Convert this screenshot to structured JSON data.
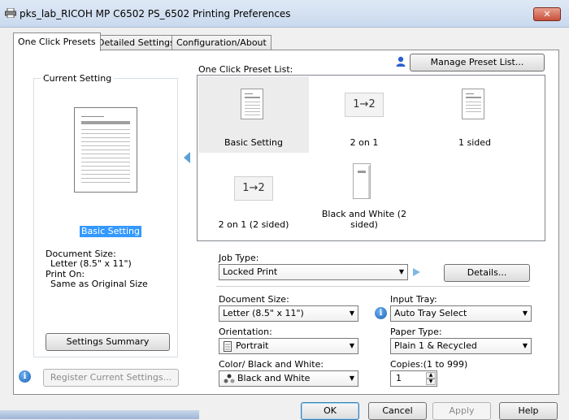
{
  "window": {
    "title": "pks_lab_RICOH MP C6502 PS_6502 Printing Preferences",
    "close_label": "✕"
  },
  "tabs": [
    {
      "label": "One Click Presets",
      "active": true
    },
    {
      "label": "Detailed Settings",
      "active": false
    },
    {
      "label": "Configuration/About",
      "active": false
    }
  ],
  "current_setting": {
    "group_label": "Current Setting",
    "selected_name": "Basic Setting",
    "doc_size_label": "Document Size:",
    "doc_size_value": "Letter (8.5\" x 11\")",
    "print_on_label": "Print On:",
    "print_on_value": "Same as Original Size",
    "summary_button": "Settings Summary",
    "register_button": "Register Current Settings..."
  },
  "preset_list": {
    "label": "One Click Preset List:",
    "manage_button": "Manage Preset List...",
    "items": [
      {
        "label": "Basic Setting",
        "selected": true
      },
      {
        "label": "2 on 1",
        "glyph": "1→2"
      },
      {
        "label": "1 sided"
      },
      {
        "label": "2 on 1 (2 sided)",
        "glyph": "1→2"
      },
      {
        "label": "Black and White (2 sided)"
      }
    ]
  },
  "job_type": {
    "label": "Job Type:",
    "value": "Locked Print",
    "details_button": "Details..."
  },
  "document_size": {
    "label": "Document Size:",
    "value": "Letter (8.5\" x 11\")"
  },
  "input_tray": {
    "label": "Input Tray:",
    "value": "Auto Tray Select"
  },
  "orientation": {
    "label": "Orientation:",
    "value": "Portrait"
  },
  "paper_type": {
    "label": "Paper Type:",
    "value": "Plain 1 & Recycled"
  },
  "color": {
    "label": "Color/ Black and White:",
    "value": "Black and White"
  },
  "copies": {
    "label": "Copies:(1 to 999)",
    "value": "1"
  },
  "footer": {
    "ok": "OK",
    "cancel": "Cancel",
    "apply": "Apply",
    "help": "Help"
  },
  "icons": {
    "info": "i",
    "dropdown": "▼",
    "spin_up": "▲",
    "spin_down": "▼"
  },
  "colors": {
    "selection": "#3399ff",
    "accent_arrow": "#5aa0d8"
  }
}
